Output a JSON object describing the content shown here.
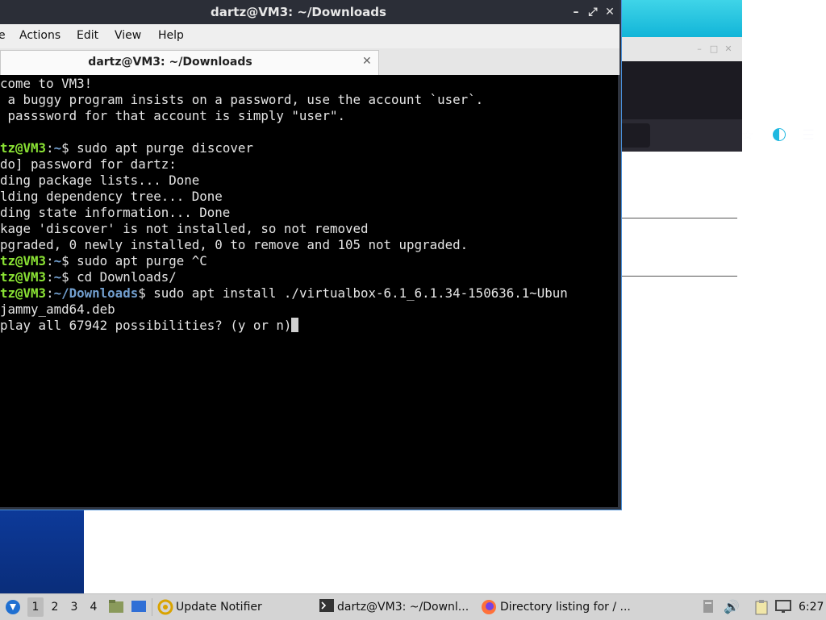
{
  "terminal": {
    "window_title": "dartz@VM3: ~/Downloads",
    "menu": [
      "e",
      "Actions",
      "Edit",
      "View",
      "Help"
    ],
    "tab_label": "dartz@VM3: ~/Downloads",
    "lines": [
      {
        "text": "come to VM3!"
      },
      {
        "text": " a buggy program insists on a password, use the account `user`."
      },
      {
        "text": " passsword for that account is simply \"user\"."
      },
      {
        "text": ""
      },
      {
        "user": "tz@VM3",
        "sep": ":",
        "dir": "~",
        "sym": "$",
        "cmd": " sudo apt purge discover"
      },
      {
        "text": "do] password for dartz:"
      },
      {
        "text": "ding package lists... Done"
      },
      {
        "text": "lding dependency tree... Done"
      },
      {
        "text": "ding state information... Done"
      },
      {
        "text": "kage 'discover' is not installed, so not removed"
      },
      {
        "text": "pgraded, 0 newly installed, 0 to remove and 105 not upgraded."
      },
      {
        "user": "tz@VM3",
        "sep": ":",
        "dir": "~",
        "sym": "$",
        "cmd": " sudo apt purge ^C"
      },
      {
        "user": "tz@VM3",
        "sep": ":",
        "dir": "~",
        "sym": "$",
        "cmd": " cd Downloads/"
      },
      {
        "user": "tz@VM3",
        "sep": ":",
        "dir": "~/Downloads",
        "sym": "$",
        "cmd": " sudo apt install ./virtualbox-6.1_6.1.34-150636.1~Ubun"
      },
      {
        "text": "jammy_amd64.deb"
      },
      {
        "text": "play all 67942 possibilities? (y or n)",
        "cursor": true
      }
    ]
  },
  "browser": {
    "new_tab_icon": "plus-icon",
    "nav_icons": [
      "bookmark-star-icon",
      "account-icon",
      "menu-icon"
    ]
  },
  "taskbar": {
    "workspaces": [
      "1",
      "2",
      "3",
      "4"
    ],
    "active_workspace": "1",
    "tasks": [
      {
        "label": "Update Notifier"
      },
      {
        "label": "dartz@VM3: ~/Downl..."
      },
      {
        "label": "Directory listing for / ..."
      }
    ],
    "clock": "6:27"
  }
}
